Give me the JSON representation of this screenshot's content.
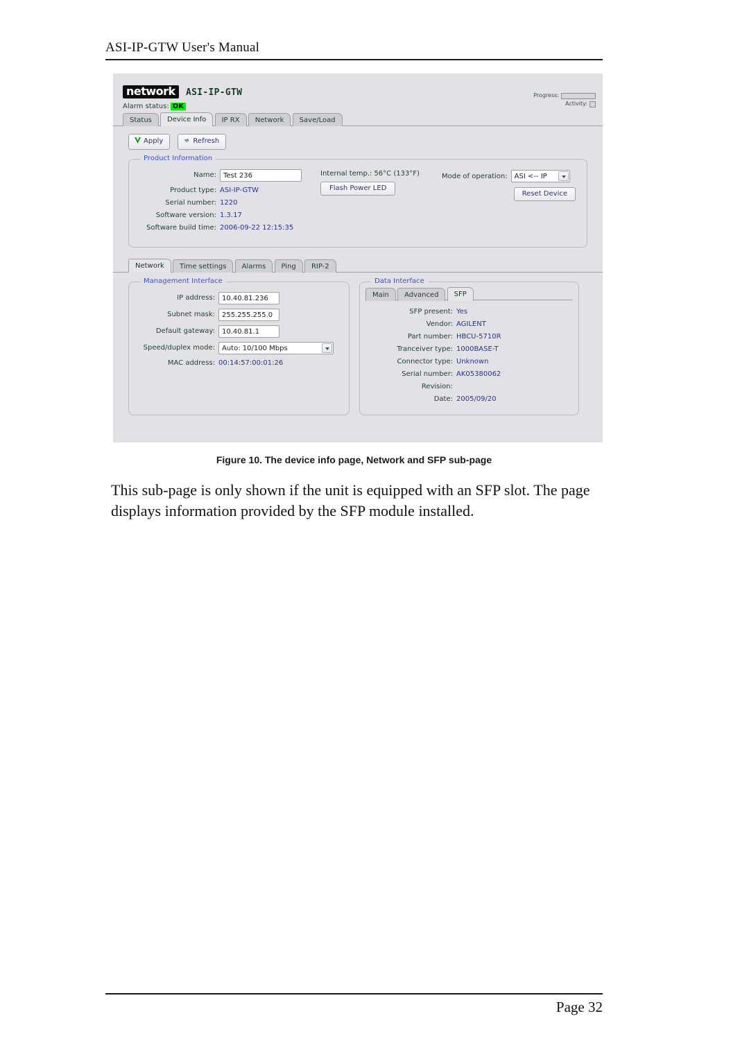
{
  "document": {
    "header_title": "ASI-IP-GTW User's Manual",
    "figure_caption": "Figure 10. The device info page, Network and SFP sub-page",
    "body_paragraph": "This sub-page is only shown if the unit is equipped with an SFP slot. The page displays information provided by the SFP module installed.",
    "page_label": "Page 32"
  },
  "app": {
    "logo_text": "network",
    "model": "ASI-IP-GTW",
    "alarm": {
      "label": "Alarm status:",
      "value": "OK",
      "color": "#00f000"
    },
    "indicators": {
      "progress_label": "Progress:",
      "activity_label": "Activity:"
    },
    "main_tabs": [
      {
        "label": "Status",
        "active": false
      },
      {
        "label": "Device Info",
        "active": true
      },
      {
        "label": "IP RX",
        "active": false
      },
      {
        "label": "Network",
        "active": false
      },
      {
        "label": "Save/Load",
        "active": false
      }
    ],
    "actions": {
      "apply": "Apply",
      "refresh": "Refresh"
    },
    "product_information": {
      "legend": "Product Information",
      "name_label": "Name:",
      "name_value": "Test 236",
      "rows": [
        {
          "label": "Product type:",
          "value": "ASI-IP-GTW"
        },
        {
          "label": "Serial number:",
          "value": "1220"
        },
        {
          "label": "Software version:",
          "value": "1.3.17"
        },
        {
          "label": "Software build time:",
          "value": "2006-09-22 12:15:35"
        }
      ],
      "internal_temp_label": "Internal temp.:",
      "internal_temp_value": "56°C (133°F)",
      "flash_power_led": "Flash Power LED",
      "mode_label": "Mode of operation:",
      "mode_value": "ASI <-- IP",
      "reset_device": "Reset Device"
    },
    "sub_tabs": [
      {
        "label": "Network",
        "active": true
      },
      {
        "label": "Time settings",
        "active": false
      },
      {
        "label": "Alarms",
        "active": false
      },
      {
        "label": "Ping",
        "active": false
      },
      {
        "label": "RIP-2",
        "active": false
      }
    ],
    "management_interface": {
      "legend": "Management Interface",
      "ip_label": "IP address:",
      "ip_value": "10.40.81.236",
      "subnet_label": "Subnet mask:",
      "subnet_value": "255.255.255.0",
      "gateway_label": "Default gateway:",
      "gateway_value": "10.40.81.1",
      "speed_label": "Speed/duplex mode:",
      "speed_value": "Auto: 10/100 Mbps",
      "mac_label": "MAC address:",
      "mac_value": "00:14:57:00:01:26"
    },
    "data_interface": {
      "legend": "Data Interface",
      "tabs": [
        {
          "label": "Main",
          "active": false
        },
        {
          "label": "Advanced",
          "active": false
        },
        {
          "label": "SFP",
          "active": true
        }
      ],
      "rows": [
        {
          "label": "SFP present:",
          "value": "Yes"
        },
        {
          "label": "Vendor:",
          "value": "AGILENT"
        },
        {
          "label": "Part number:",
          "value": "HBCU-5710R"
        },
        {
          "label": "Tranceiver type:",
          "value": "1000BASE-T"
        },
        {
          "label": "Connector type:",
          "value": "Unknown"
        },
        {
          "label": "Serial number:",
          "value": "AK05380062"
        },
        {
          "label": "Revision:",
          "value": ""
        },
        {
          "label": "Date:",
          "value": "2005/09/20"
        }
      ]
    }
  }
}
